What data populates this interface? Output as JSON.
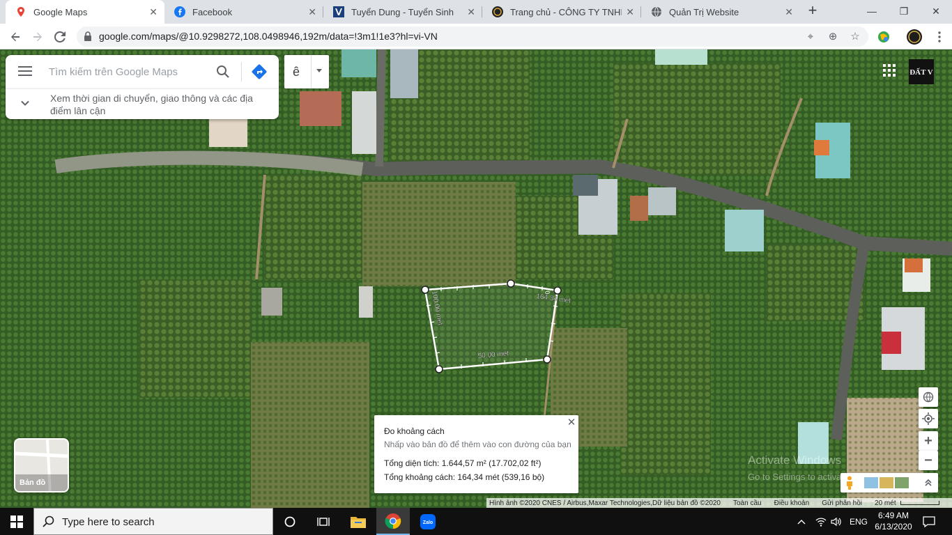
{
  "tabs": [
    {
      "label": "Google Maps",
      "icon": "google-maps-icon",
      "active": true
    },
    {
      "label": "Facebook",
      "icon": "facebook-icon",
      "active": false
    },
    {
      "label": "Tuyển Dung - Tuyển Sinh",
      "icon": "site-logo-icon",
      "active": false
    },
    {
      "label": "Trang chủ - CÔNG TY TNHH Đ",
      "icon": "company-logo-icon",
      "active": false
    },
    {
      "label": "Quản Trị Website",
      "icon": "globe-icon",
      "active": false
    }
  ],
  "browser": {
    "url": "google.com/maps/@10.9298272,108.0498946,192m/data=!3m1!1e3?hl=vi-VN"
  },
  "maps": {
    "search_placeholder": "Tìm kiếm trên Google Maps",
    "nearby_text": "Xem thời gian di chuyển, giao thông và các địa điểm lân cận",
    "ime_char": "ê",
    "profile_logo_text": "ĐẤT V",
    "layer_label": "Bản đồ",
    "measure": {
      "title": "Đo khoảng cách",
      "hint": "Nhấp vào bản đồ để thêm vào con đường của bạn",
      "area": "Tổng diện tích: 1.644,57 m² (17.702,02 ft²)",
      "distance": "Tổng khoảng cách: 164,34 mét (539,16 bộ)"
    },
    "segment_labels": {
      "left": "100,00 mét",
      "bottom": "50,00 mét",
      "right": "164,34 mét",
      "right_small": "0"
    },
    "attribution": {
      "imagery": "Hình ảnh ©2020 CNES / Airbus,Maxar Technologies,Dữ liệu bản đồ ©2020",
      "privacy": "Toàn cầu",
      "terms": "Điều khoản",
      "feedback": "Gửi phản hồi",
      "scale": "20 mét"
    },
    "watermark": {
      "line1": "Activate Windows",
      "line2": "Go to Settings to activate Windows."
    }
  },
  "taskbar": {
    "search_text": "Type here to search",
    "language": "ENG",
    "time": "6:49 AM",
    "date": "6/13/2020"
  },
  "colors": {
    "accent_blue": "#1a73e8",
    "map_green": "#3d6a2c",
    "road": "#5c5f5a"
  }
}
